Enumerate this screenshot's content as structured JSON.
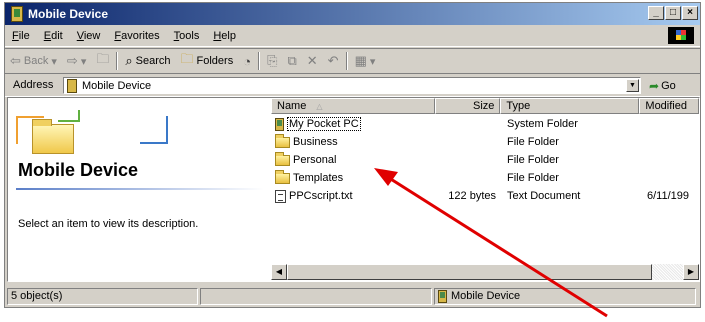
{
  "window": {
    "title": "Mobile Device"
  },
  "menu": [
    "File",
    "Edit",
    "View",
    "Favorites",
    "Tools",
    "Help"
  ],
  "toolbar": {
    "back": "Back",
    "search": "Search",
    "folders": "Folders"
  },
  "address": {
    "label": "Address",
    "value": "Mobile Device",
    "go": "Go"
  },
  "left_pane": {
    "title": "Mobile Device",
    "description": "Select an item to view its description."
  },
  "columns": [
    "Name",
    "Size",
    "Type",
    "Modified"
  ],
  "items": [
    {
      "name": "My Pocket PC",
      "size": "",
      "type": "System Folder",
      "modified": "",
      "icon": "pocket-pc-icon"
    },
    {
      "name": "Business",
      "size": "",
      "type": "File Folder",
      "modified": "",
      "icon": "folder-icon"
    },
    {
      "name": "Personal",
      "size": "",
      "type": "File Folder",
      "modified": "",
      "icon": "folder-icon"
    },
    {
      "name": "Templates",
      "size": "",
      "type": "File Folder",
      "modified": "",
      "icon": "folder-icon"
    },
    {
      "name": "PPCscript.txt",
      "size": "122 bytes",
      "type": "Text Document",
      "modified": "6/11/199",
      "icon": "text-file-icon"
    }
  ],
  "status": {
    "objects": "5 object(s)",
    "location": "Mobile Device"
  },
  "colors": {
    "title_start": "#0a246a",
    "title_end": "#a6caf0",
    "annotation_arrow": "#e00000"
  }
}
